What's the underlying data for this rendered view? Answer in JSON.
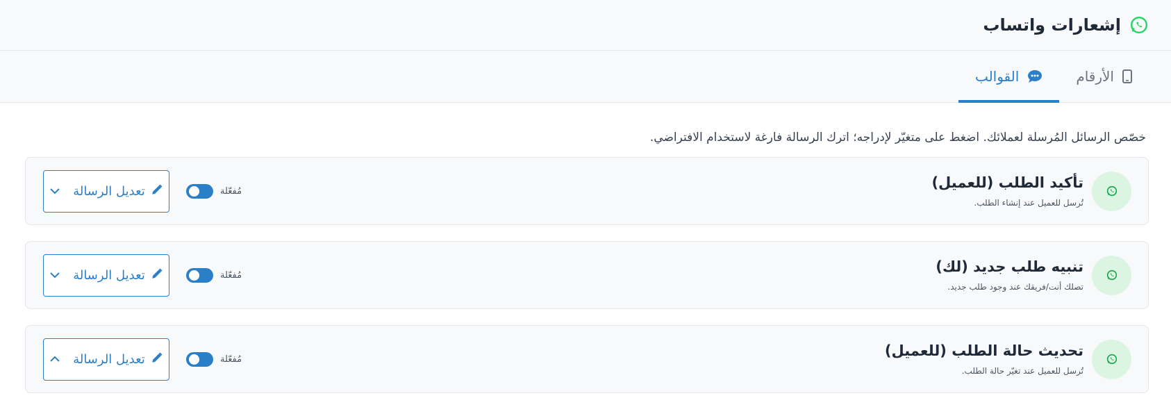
{
  "header": {
    "title": "إشعارات واتساب",
    "icon": "whatsapp-icon"
  },
  "tabs": [
    {
      "label": "الأرقام",
      "icon": "mobile-icon",
      "active": false
    },
    {
      "label": "القوالب",
      "icon": "chat-bubble-icon",
      "active": true
    }
  ],
  "description": "خصّص الرسائل المُرسلة لعملائك. اضغط على متغيّر لإدراجه؛ اترك الرسالة فارغة لاستخدام الافتراضي.",
  "colors": {
    "accent": "#2b7fc9",
    "whatsapp": "#25d366",
    "icon_bg": "#dcf5e3"
  },
  "cards": [
    {
      "title": "تأكيد الطلب (للعميل)",
      "subtitle": "تُرسل للعميل عند إنشاء الطلب.",
      "toggle_label": "مُفعّلة",
      "edit_label": "تعديل الرسالة",
      "expanded": false
    },
    {
      "title": "تنبيه طلب جديد (لك)",
      "subtitle": "تصلك أنت/فريقك عند وجود طلب جديد.",
      "toggle_label": "مُفعّلة",
      "edit_label": "تعديل الرسالة",
      "expanded": false
    },
    {
      "title": "تحديث حالة الطلب (للعميل)",
      "subtitle": "تُرسل للعميل عند تغيّر حالة الطلب.",
      "toggle_label": "مُفعّلة",
      "edit_label": "تعديل الرسالة",
      "expanded": true
    }
  ]
}
